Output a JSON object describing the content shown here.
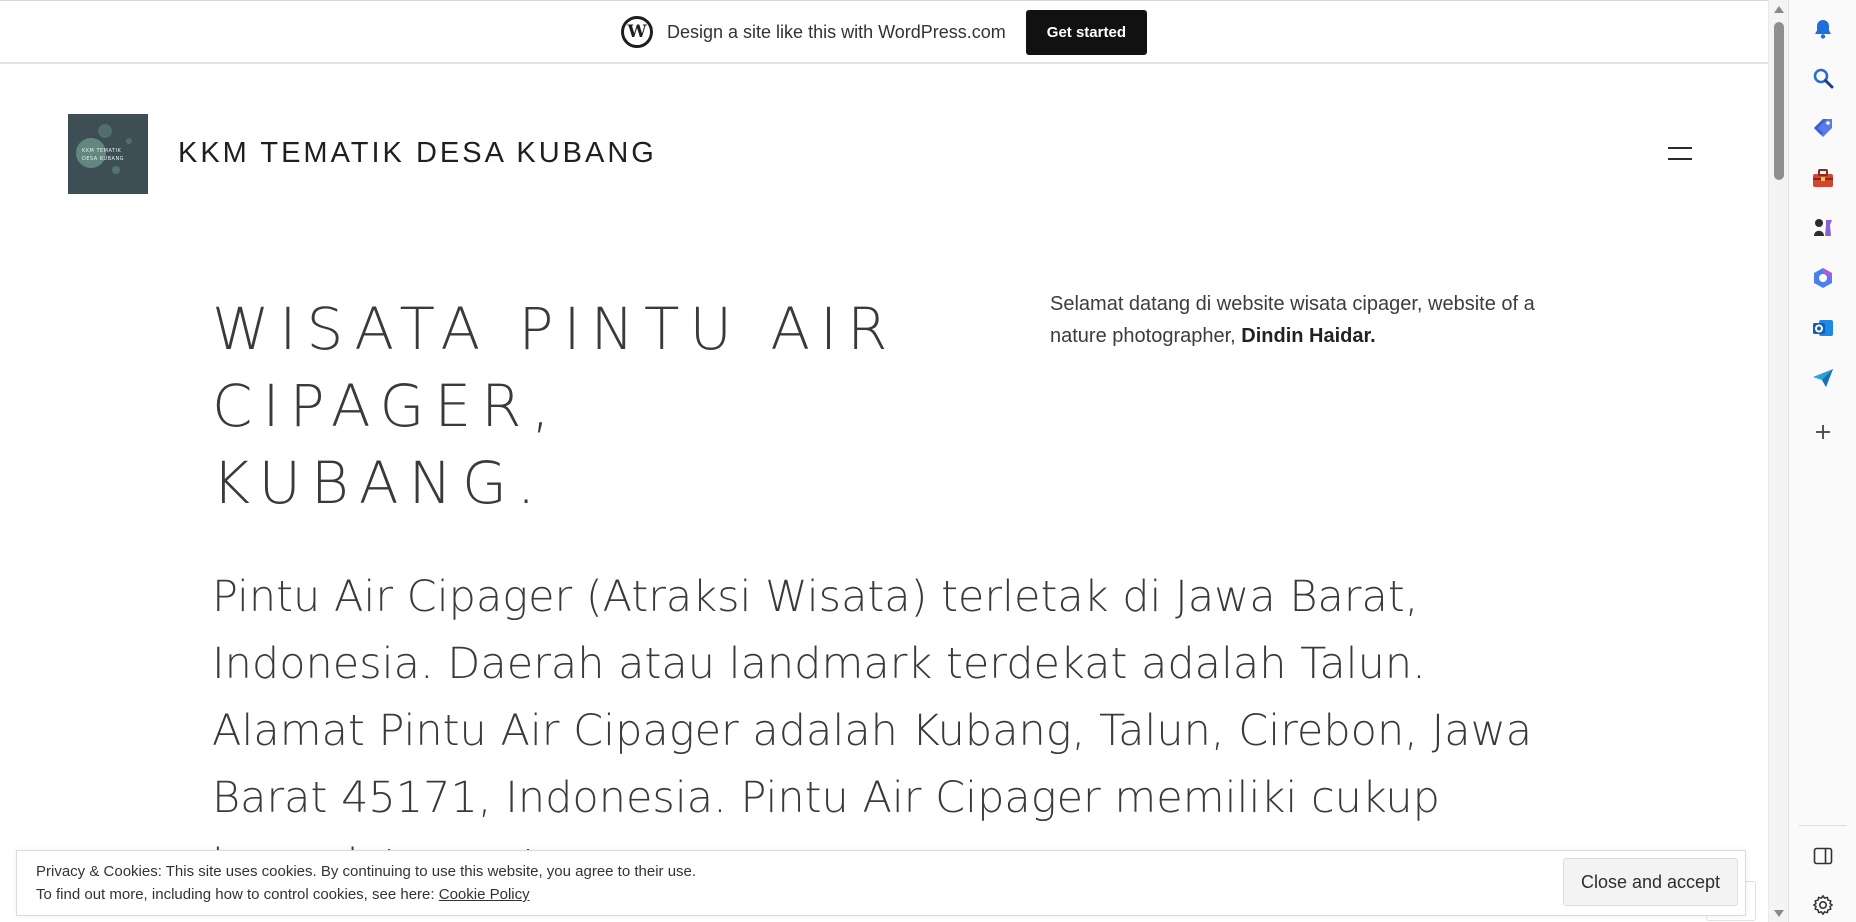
{
  "promo_banner": {
    "text": "Design a site like this with WordPress.com",
    "button_label": "Get started"
  },
  "site": {
    "title": "KKM TEMATIK DESA KUBANG",
    "logo_text_line1": "KKM TEMATIK",
    "logo_text_line2": "DESA KUBANG"
  },
  "hero": {
    "title_line1": "WISATA PINTU AIR",
    "title_line2": "CIPAGER, KUBANG.",
    "intro_text": "Selamat datang di website wisata cipager, website of a nature photographer,",
    "intro_author": "Dindin Haidar."
  },
  "body": {
    "paragraph": "Pintu Air Cipager (Atraksi Wisata) terletak di Jawa Barat, Indonesia. Daerah atau landmark terdekat adalah Talun. Alamat Pintu Air Cipager adalah Kubang, Talun, Cirebon, Jawa Barat 45171, Indonesia. Pintu Air Cipager memiliki cukup banyak tempat yang"
  },
  "cookie_bar": {
    "line1": "Privacy & Cookies: This site uses cookies. By continuing to use this website, you agree to their use.",
    "line2_prefix": "To find out more, including how to control cookies, see here:",
    "policy_link": "Cookie Policy",
    "accept_button": "Close and accept"
  },
  "side_panel": {
    "icons": [
      "bell-icon",
      "search-icon",
      "tag-icon",
      "toolbox-icon",
      "chess-icon",
      "copilot-icon",
      "outlook-icon",
      "send-icon",
      "add-icon",
      "split-screen-icon",
      "settings-icon"
    ]
  }
}
